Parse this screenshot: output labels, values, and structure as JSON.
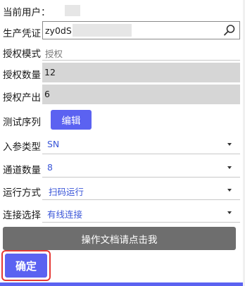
{
  "current_user": {
    "label": "当前用户："
  },
  "production_credential": {
    "label": "生产凭证",
    "value": "zy0dS",
    "search_icon": "search-icon"
  },
  "auth_mode": {
    "label": "授权模式",
    "value": "授权"
  },
  "auth_count": {
    "label": "授权数量",
    "value": "12"
  },
  "auth_output": {
    "label": "授权产出",
    "value": "6"
  },
  "test_sequence": {
    "label": "测试序列",
    "edit_label": "编辑"
  },
  "param_type": {
    "label": "入参类型",
    "value": "SN"
  },
  "channel_count": {
    "label": "通道数量",
    "value": "8"
  },
  "run_mode": {
    "label": "运行方式",
    "value": "扫码运行"
  },
  "connection": {
    "label": "连接选择",
    "value": "有线连接"
  },
  "doc_button": {
    "label": "操作文档请点击我"
  },
  "confirm_button": {
    "label": "确定"
  },
  "colors": {
    "accent": "#5b62f1",
    "select_text": "#3a56d8",
    "readonly_field": "#d6d6d6",
    "doc_button": "#6e6e6e",
    "highlight": "#e53935"
  }
}
